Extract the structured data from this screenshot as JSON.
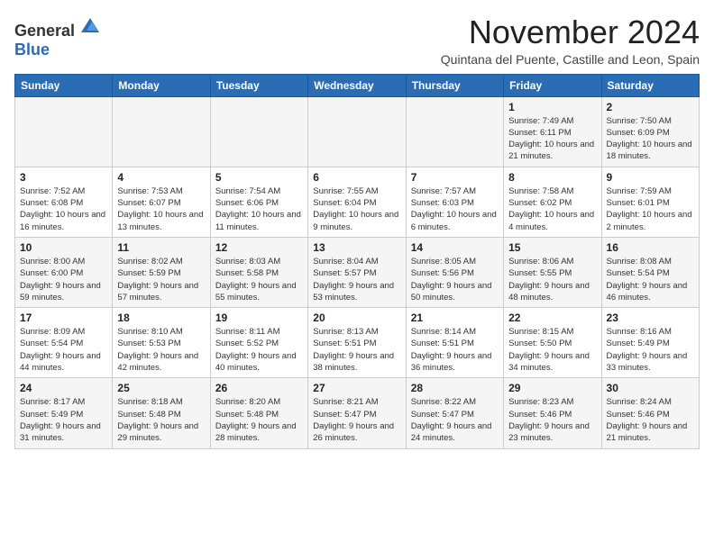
{
  "logo": {
    "general": "General",
    "blue": "Blue"
  },
  "title": "November 2024",
  "subtitle": "Quintana del Puente, Castille and Leon, Spain",
  "weekdays": [
    "Sunday",
    "Monday",
    "Tuesday",
    "Wednesday",
    "Thursday",
    "Friday",
    "Saturday"
  ],
  "weeks": [
    [
      {
        "day": "",
        "info": ""
      },
      {
        "day": "",
        "info": ""
      },
      {
        "day": "",
        "info": ""
      },
      {
        "day": "",
        "info": ""
      },
      {
        "day": "",
        "info": ""
      },
      {
        "day": "1",
        "info": "Sunrise: 7:49 AM\nSunset: 6:11 PM\nDaylight: 10 hours and 21 minutes."
      },
      {
        "day": "2",
        "info": "Sunrise: 7:50 AM\nSunset: 6:09 PM\nDaylight: 10 hours and 18 minutes."
      }
    ],
    [
      {
        "day": "3",
        "info": "Sunrise: 7:52 AM\nSunset: 6:08 PM\nDaylight: 10 hours and 16 minutes."
      },
      {
        "day": "4",
        "info": "Sunrise: 7:53 AM\nSunset: 6:07 PM\nDaylight: 10 hours and 13 minutes."
      },
      {
        "day": "5",
        "info": "Sunrise: 7:54 AM\nSunset: 6:06 PM\nDaylight: 10 hours and 11 minutes."
      },
      {
        "day": "6",
        "info": "Sunrise: 7:55 AM\nSunset: 6:04 PM\nDaylight: 10 hours and 9 minutes."
      },
      {
        "day": "7",
        "info": "Sunrise: 7:57 AM\nSunset: 6:03 PM\nDaylight: 10 hours and 6 minutes."
      },
      {
        "day": "8",
        "info": "Sunrise: 7:58 AM\nSunset: 6:02 PM\nDaylight: 10 hours and 4 minutes."
      },
      {
        "day": "9",
        "info": "Sunrise: 7:59 AM\nSunset: 6:01 PM\nDaylight: 10 hours and 2 minutes."
      }
    ],
    [
      {
        "day": "10",
        "info": "Sunrise: 8:00 AM\nSunset: 6:00 PM\nDaylight: 9 hours and 59 minutes."
      },
      {
        "day": "11",
        "info": "Sunrise: 8:02 AM\nSunset: 5:59 PM\nDaylight: 9 hours and 57 minutes."
      },
      {
        "day": "12",
        "info": "Sunrise: 8:03 AM\nSunset: 5:58 PM\nDaylight: 9 hours and 55 minutes."
      },
      {
        "day": "13",
        "info": "Sunrise: 8:04 AM\nSunset: 5:57 PM\nDaylight: 9 hours and 53 minutes."
      },
      {
        "day": "14",
        "info": "Sunrise: 8:05 AM\nSunset: 5:56 PM\nDaylight: 9 hours and 50 minutes."
      },
      {
        "day": "15",
        "info": "Sunrise: 8:06 AM\nSunset: 5:55 PM\nDaylight: 9 hours and 48 minutes."
      },
      {
        "day": "16",
        "info": "Sunrise: 8:08 AM\nSunset: 5:54 PM\nDaylight: 9 hours and 46 minutes."
      }
    ],
    [
      {
        "day": "17",
        "info": "Sunrise: 8:09 AM\nSunset: 5:54 PM\nDaylight: 9 hours and 44 minutes."
      },
      {
        "day": "18",
        "info": "Sunrise: 8:10 AM\nSunset: 5:53 PM\nDaylight: 9 hours and 42 minutes."
      },
      {
        "day": "19",
        "info": "Sunrise: 8:11 AM\nSunset: 5:52 PM\nDaylight: 9 hours and 40 minutes."
      },
      {
        "day": "20",
        "info": "Sunrise: 8:13 AM\nSunset: 5:51 PM\nDaylight: 9 hours and 38 minutes."
      },
      {
        "day": "21",
        "info": "Sunrise: 8:14 AM\nSunset: 5:51 PM\nDaylight: 9 hours and 36 minutes."
      },
      {
        "day": "22",
        "info": "Sunrise: 8:15 AM\nSunset: 5:50 PM\nDaylight: 9 hours and 34 minutes."
      },
      {
        "day": "23",
        "info": "Sunrise: 8:16 AM\nSunset: 5:49 PM\nDaylight: 9 hours and 33 minutes."
      }
    ],
    [
      {
        "day": "24",
        "info": "Sunrise: 8:17 AM\nSunset: 5:49 PM\nDaylight: 9 hours and 31 minutes."
      },
      {
        "day": "25",
        "info": "Sunrise: 8:18 AM\nSunset: 5:48 PM\nDaylight: 9 hours and 29 minutes."
      },
      {
        "day": "26",
        "info": "Sunrise: 8:20 AM\nSunset: 5:48 PM\nDaylight: 9 hours and 28 minutes."
      },
      {
        "day": "27",
        "info": "Sunrise: 8:21 AM\nSunset: 5:47 PM\nDaylight: 9 hours and 26 minutes."
      },
      {
        "day": "28",
        "info": "Sunrise: 8:22 AM\nSunset: 5:47 PM\nDaylight: 9 hours and 24 minutes."
      },
      {
        "day": "29",
        "info": "Sunrise: 8:23 AM\nSunset: 5:46 PM\nDaylight: 9 hours and 23 minutes."
      },
      {
        "day": "30",
        "info": "Sunrise: 8:24 AM\nSunset: 5:46 PM\nDaylight: 9 hours and 21 minutes."
      }
    ]
  ]
}
